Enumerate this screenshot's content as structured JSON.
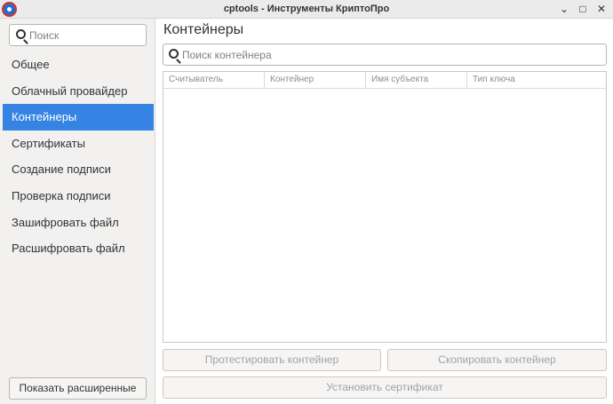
{
  "window": {
    "title": "cptools - Инструменты КриптоПро",
    "min_glyph": "⌄",
    "max_glyph": "□",
    "close_glyph": "✕"
  },
  "sidebar": {
    "search_placeholder": "Поиск",
    "items": [
      {
        "label": "Общее"
      },
      {
        "label": "Облачный провайдер"
      },
      {
        "label": "Контейнеры",
        "active": true
      },
      {
        "label": "Сертификаты"
      },
      {
        "label": "Создание подписи"
      },
      {
        "label": "Проверка подписи"
      },
      {
        "label": "Зашифровать файл"
      },
      {
        "label": "Расшифровать файл"
      }
    ],
    "advanced_button": "Показать расширенные"
  },
  "main": {
    "title": "Контейнеры",
    "search_placeholder": "Поиск контейнера",
    "table": {
      "columns": [
        "Считыватель",
        "Контейнер",
        "Имя субъекта",
        "Тип ключа"
      ],
      "rows": []
    },
    "buttons": {
      "test": "Протестировать контейнер",
      "copy": "Скопировать контейнер",
      "install": "Установить сертификат"
    }
  },
  "colors": {
    "accent": "#3584e4",
    "sidebar_bg": "#f2f1f0"
  }
}
